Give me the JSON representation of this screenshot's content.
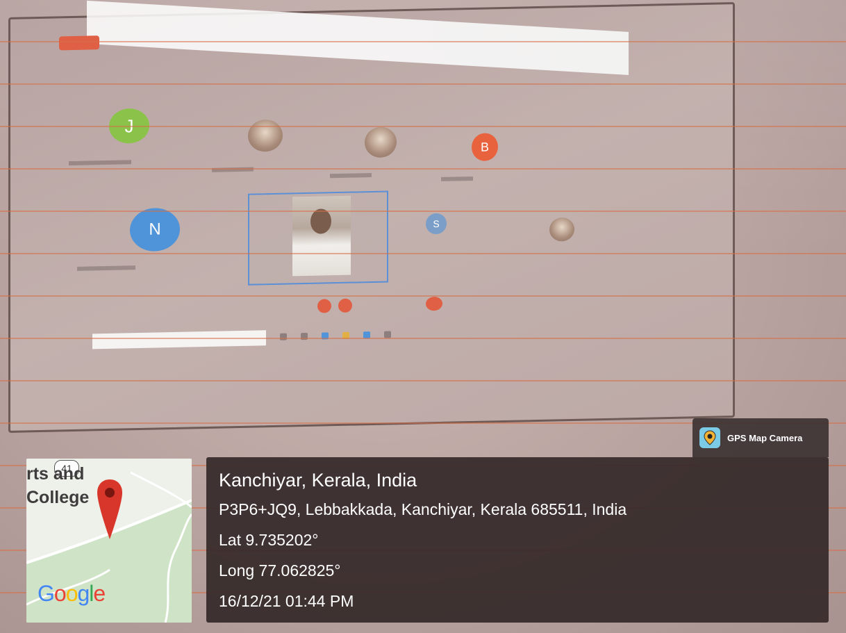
{
  "gps_camera": {
    "app_name": "GPS Map Camera",
    "accent_color": "#7ccbe6"
  },
  "location": {
    "place": "Kanchiyar, Kerala, India",
    "address": "P3P6+JQ9, Lebbakkada, Kanchiyar, Kerala 685511, India",
    "latitude": "Lat 9.735202°",
    "longitude": "Long 77.062825°",
    "datetime": "16/12/21 01:44 PM"
  },
  "map": {
    "road_number": "41",
    "label_line1": "rts and",
    "label_line2": "College",
    "brand": "Google",
    "pin_color": "#d9362b"
  },
  "projected_meeting": {
    "participants": [
      {
        "initial": "J",
        "color": "#8bc34a"
      },
      {
        "initial": "B",
        "color": "#e8633d"
      },
      {
        "initial": "N",
        "color": "#4f93d8"
      },
      {
        "initial": "S",
        "color": "#7a9ec7"
      }
    ]
  }
}
